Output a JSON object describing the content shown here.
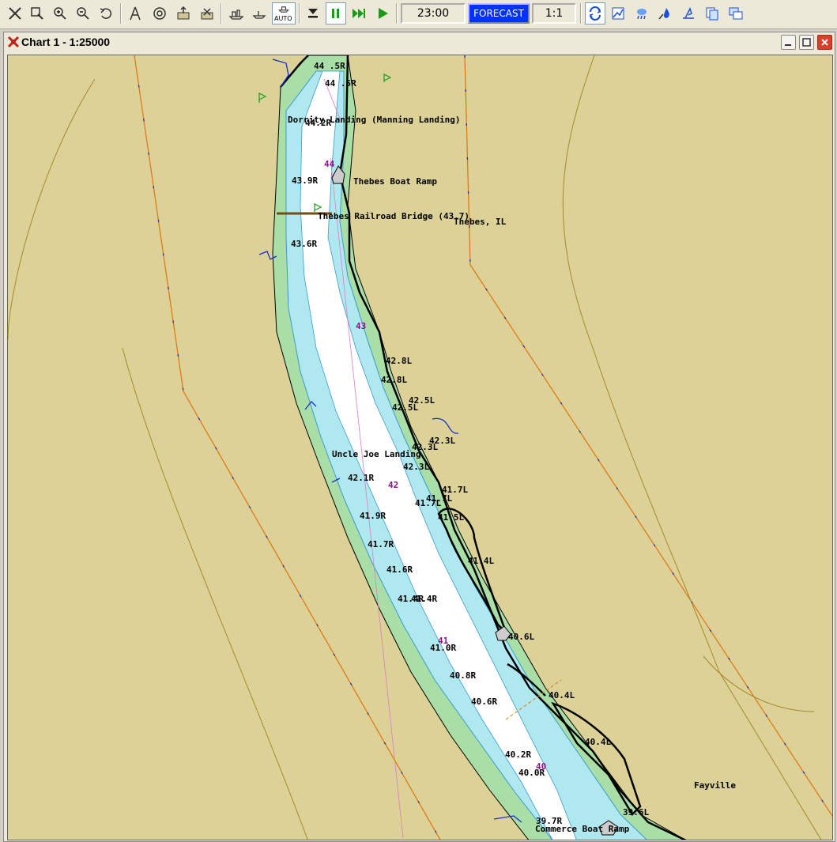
{
  "toolbar": {
    "time": "23:00",
    "forecast": "FORECAST",
    "scale": "1:1",
    "auto_label": "AUTO"
  },
  "window": {
    "title": "Chart 1 - 1:25000"
  },
  "map": {
    "places": {
      "dorrity": "Dorrity Landing (Manning Landing)",
      "thebes_ramp": "Thebes Boat Ramp",
      "thebes_bridge": "Thebes Railroad Bridge (43.7)",
      "thebes_il": "Thebes, IL",
      "uncle_joe": "Uncle Joe Landing",
      "fayville": "Fayville",
      "commerce": "Commerce Boat Ramp"
    },
    "river_miles": [
      "44",
      "43",
      "42",
      "41",
      "40"
    ],
    "markers": [
      "44 .5R",
      "44 .5R",
      "44.2R",
      "43.9R",
      "43.6R",
      "42.8L",
      "42.8L",
      "42.5L",
      "42.5L",
      "42.3L",
      "42.3L",
      "42.3L",
      "42.1R",
      "41.7L",
      "41.7L",
      "41.7L",
      "41.5L",
      "41.9R",
      "41.7R",
      "41.6R",
      "41.4L",
      "41.4R",
      "41.4R",
      "40.6L",
      "41.0R",
      "40.8R",
      "40.6R",
      "40.4L",
      "40.4L",
      "40.2R",
      "40.0R",
      "39.7R",
      "39.6L"
    ]
  }
}
